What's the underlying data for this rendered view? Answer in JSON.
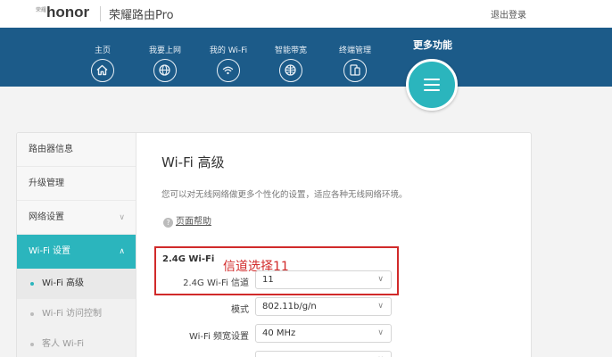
{
  "header": {
    "brand_small": "荣耀",
    "logo": "honor",
    "product": "荣耀路由Pro",
    "logout": "退出登录"
  },
  "nav": {
    "items": [
      {
        "label": "主页",
        "icon": "home-icon"
      },
      {
        "label": "我要上网",
        "icon": "globe-icon"
      },
      {
        "label": "我的 Wi-Fi",
        "icon": "wifi-icon"
      },
      {
        "label": "智能带宽",
        "icon": "bandwidth-globe-icon"
      },
      {
        "label": "终端管理",
        "icon": "devices-icon"
      }
    ],
    "more_label": "更多功能",
    "more_icon": "menu-icon"
  },
  "sidebar": {
    "items": [
      {
        "label": "路由器信息"
      },
      {
        "label": "升级管理"
      },
      {
        "label": "网络设置"
      },
      {
        "label": "Wi-Fi 设置"
      }
    ],
    "subitems": [
      {
        "label": "Wi-Fi 高级"
      },
      {
        "label": "Wi-Fi 访问控制"
      },
      {
        "label": "客人 Wi-Fi"
      }
    ],
    "chevron_down": "∨",
    "chevron_up": "∧"
  },
  "main": {
    "title": "Wi-Fi 高级",
    "description": "您可以对无线网络做更多个性化的设置，适应各种无线网络环境。",
    "help_icon": "?",
    "help_link": "页面帮助",
    "section_title": "2.4G Wi-Fi",
    "annotation": "信道选择11",
    "rows": [
      {
        "label": "2.4G Wi-Fi 信道",
        "value": "11"
      },
      {
        "label": "模式",
        "value": "802.11b/g/n"
      },
      {
        "label": "Wi-Fi 频宽设置",
        "value": "40 MHz"
      },
      {
        "label": "",
        "value": ""
      }
    ],
    "arrow": "∨"
  },
  "colors": {
    "nav_blue": "#1c5b89",
    "accent_teal": "#2bb5bd",
    "annotation_red": "#d12a2a"
  }
}
